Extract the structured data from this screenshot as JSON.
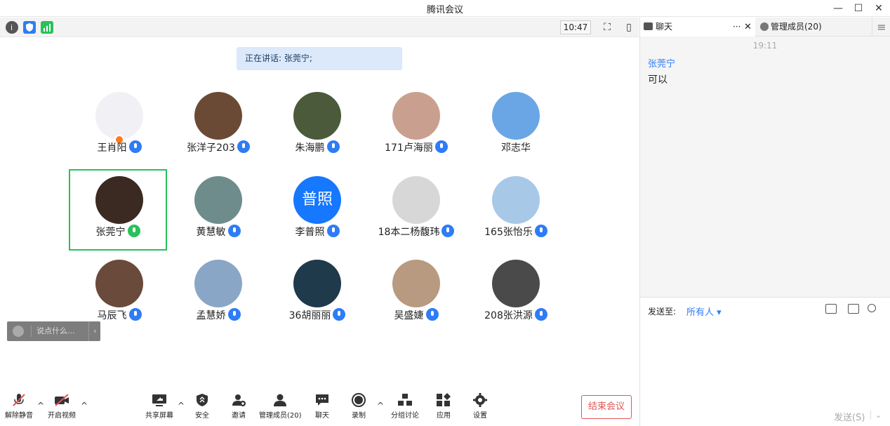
{
  "window": {
    "title": "腾讯会议"
  },
  "toolbar": {
    "time": "10:47"
  },
  "speaking": {
    "text": "正在讲话: 张莞宁;"
  },
  "participants": [
    {
      "name": "王肖阳",
      "mic": "blue",
      "host": true,
      "avatar_color": "#f1f1f5"
    },
    {
      "name": "张洋子203",
      "mic": "blue",
      "avatar_color": "#6b4a35"
    },
    {
      "name": "朱海鹏",
      "mic": "blue",
      "avatar_color": "#4a5a3a"
    },
    {
      "name": "171卢海丽",
      "mic": "blue",
      "avatar_color": "#c9a090"
    },
    {
      "name": "邓志华",
      "mic": "none",
      "avatar_color": "#6aa6e6"
    },
    {
      "name": "张莞宁",
      "mic": "green",
      "active": true,
      "avatar_color": "#3a2a22"
    },
    {
      "name": "黄慧敏",
      "mic": "blue",
      "avatar_color": "#6e8c8c"
    },
    {
      "name": "李普照",
      "mic": "blue",
      "avatar_text": "普照",
      "avatar_color": "#1677ff"
    },
    {
      "name": "18本二杨馥玮",
      "mic": "blue",
      "avatar_color": "#d7d7d7"
    },
    {
      "name": "165张怡乐",
      "mic": "blue",
      "avatar_color": "#a8c8e8"
    },
    {
      "name": "马辰飞",
      "mic": "blue",
      "avatar_color": "#6a4a3a"
    },
    {
      "name": "孟慧娇",
      "mic": "blue",
      "avatar_color": "#8aa6c6"
    },
    {
      "name": "36胡丽丽",
      "mic": "blue",
      "avatar_color": "#1f3a4a"
    },
    {
      "name": "吴盛婕",
      "mic": "blue",
      "avatar_color": "#b89a80"
    },
    {
      "name": "208张洪源",
      "mic": "blue",
      "avatar_color": "#4a4a4a"
    }
  ],
  "chat_input": {
    "placeholder": "说点什么..."
  },
  "bottombar": {
    "unmute": "解除静音",
    "video": "开启视频",
    "share": "共享屏幕",
    "security": "安全",
    "invite": "邀请",
    "members": "管理成员(20)",
    "chat": "聊天",
    "record": "录制",
    "breakout": "分组讨论",
    "apps": "应用",
    "settings": "设置",
    "end": "结束会议"
  },
  "sidepanel": {
    "chat_tab": "聊天",
    "members_tab": "管理成员(20)",
    "message_time": "19:11",
    "sender": "张莞宁",
    "message": "可以",
    "send_to_label": "发送至:",
    "send_to_value": "所有人",
    "send_button": "发送(S)"
  },
  "colors": {
    "accent": "#2e7cf6",
    "active_border": "#29c15a",
    "end_red": "#e05555"
  }
}
